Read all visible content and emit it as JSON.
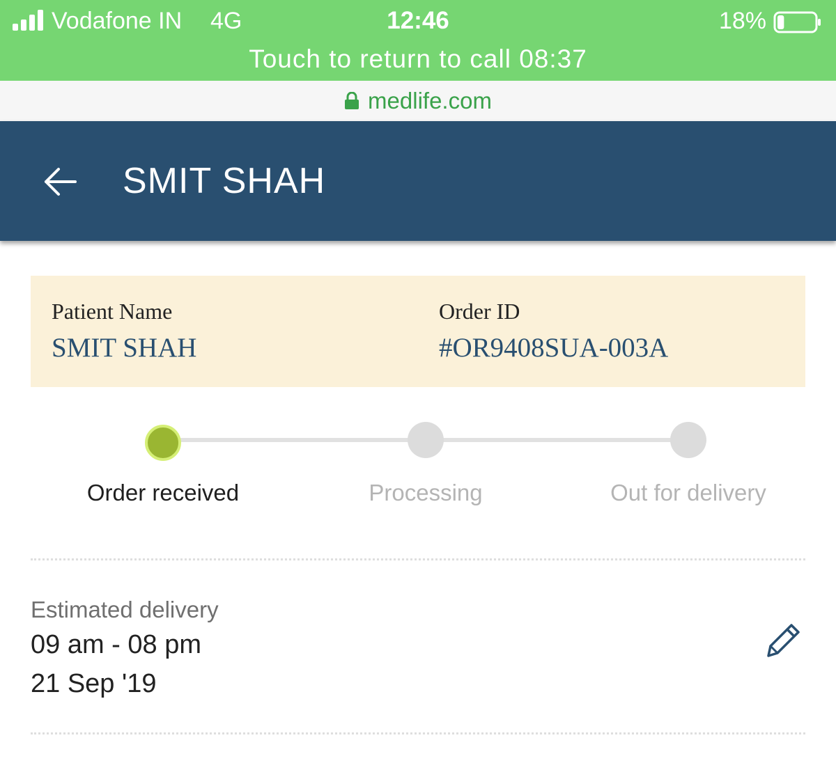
{
  "status_bar": {
    "carrier": "Vodafone IN",
    "network": "4G",
    "time": "12:46",
    "battery_percent": "18%",
    "battery_level": 0.18,
    "call_banner": "Touch to return to call 08:37",
    "icons": [
      "signal-icon",
      "battery-icon"
    ]
  },
  "url_bar": {
    "domain": "medlife.com",
    "icon": "lock-icon"
  },
  "header": {
    "title": "SMIT SHAH",
    "back_icon": "back-arrow-icon",
    "background": "#294f70"
  },
  "order_card": {
    "patient_label": "Patient Name",
    "patient_name": "SMIT SHAH",
    "order_label": "Order ID",
    "order_id": "#OR9408SUA-003A",
    "background": "#fbf1d9"
  },
  "progress": {
    "steps": [
      {
        "label": "Order received",
        "active": true
      },
      {
        "label": "Processing",
        "active": false
      },
      {
        "label": "Out for delivery",
        "active": false
      }
    ],
    "active_color": "#9ab632"
  },
  "delivery": {
    "label": "Estimated delivery",
    "time_window": "09 am - 08 pm",
    "date": "21 Sep '19",
    "edit_icon": "pencil-icon"
  },
  "colors": {
    "status_bar": "#76d672",
    "url_text": "#3aa24a"
  }
}
